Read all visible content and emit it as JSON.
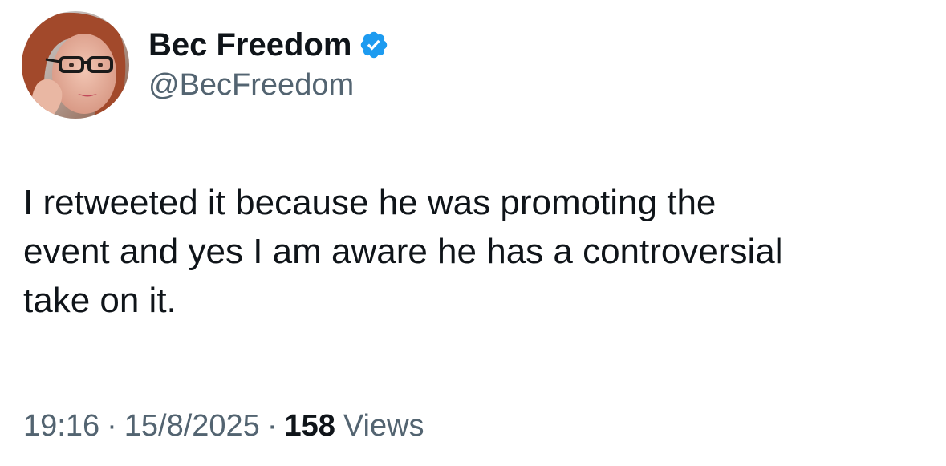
{
  "author": {
    "display_name": "Bec Freedom",
    "handle": "@BecFreedom",
    "verified": true,
    "verified_color": "#1d9bf0"
  },
  "tweet": {
    "text": "I retweeted it because he was promoting the\nevent and yes I am aware he has a controversial\ntake on it."
  },
  "meta": {
    "time": "19:16",
    "separator": "·",
    "date": "15/8/2025",
    "views_count": "158",
    "views_label": "Views"
  },
  "colors": {
    "text_primary": "#0f1419",
    "text_secondary": "#536471"
  },
  "icons": {
    "verified": "verified-badge-icon",
    "avatar": "profile-photo"
  }
}
